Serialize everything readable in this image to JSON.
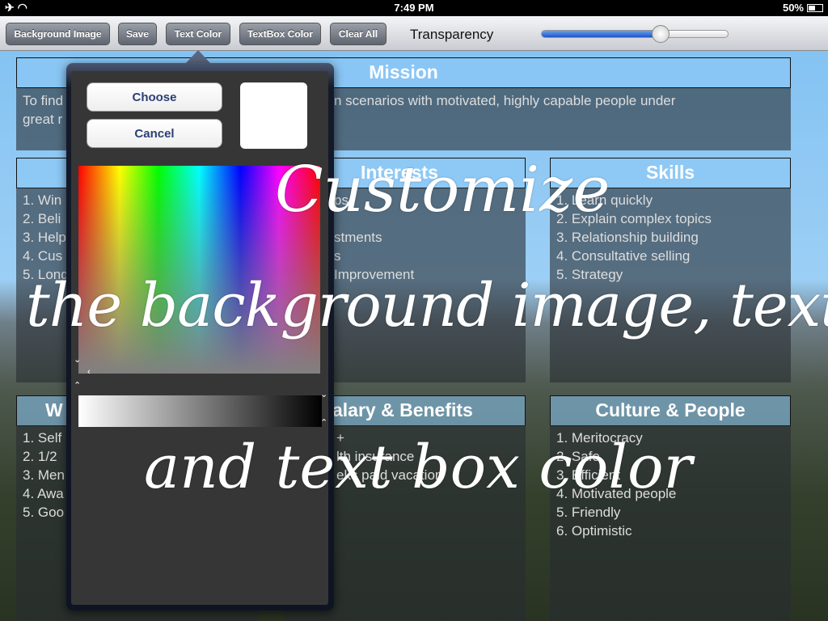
{
  "status": {
    "time": "7:49 PM",
    "battery": "50%",
    "icons": [
      "airplane-icon",
      "wifi-icon",
      "battery-icon"
    ]
  },
  "toolbar": {
    "background_image": "Background Image",
    "save": "Save",
    "text_color": "Text Color",
    "textbox_color": "TextBox Color",
    "clear_all": "Clear All",
    "transparency_label": "Transparency",
    "transparency_value": 0.64
  },
  "mission": {
    "title": "Mission",
    "text_line1": "To find",
    "text_line1_rest": "es win-win scenarios with motivated, highly capable people under",
    "text_line2": "great r"
  },
  "columns": [
    {
      "title": "",
      "items": [
        "1. Win",
        "2. Beli",
        "3. Help",
        "4. Cus",
        "5. Long"
      ]
    },
    {
      "title": "Interests",
      "items": [
        "ps",
        "",
        "stments",
        "s",
        "Improvement"
      ]
    },
    {
      "title": "Skills",
      "items": [
        "1. Learn quickly",
        "2. Explain complex topics",
        "3. Relationship building",
        "4. Consultative selling",
        "5. Strategy"
      ]
    },
    {
      "title": "W",
      "items": [
        "1. Self",
        "2. 1/2",
        "3. Men",
        "4. Awa",
        "5. Goo"
      ]
    },
    {
      "title": "alary & Benefits",
      "items": [
        "+",
        "lth insurance",
        "eks paid vacation",
        "",
        ""
      ]
    },
    {
      "title": "Culture & People",
      "items": [
        "1. Meritocracy",
        "2. Safe",
        "3. Efficient",
        "4. Motivated people",
        "5. Friendly",
        "6. Optimistic"
      ]
    }
  ],
  "color_picker": {
    "choose": "Choose",
    "cancel": "Cancel",
    "selected_color": "#ffffff"
  },
  "overlay": {
    "line1": "Customize",
    "line2": "the background image, text",
    "line3": "and text box color"
  }
}
